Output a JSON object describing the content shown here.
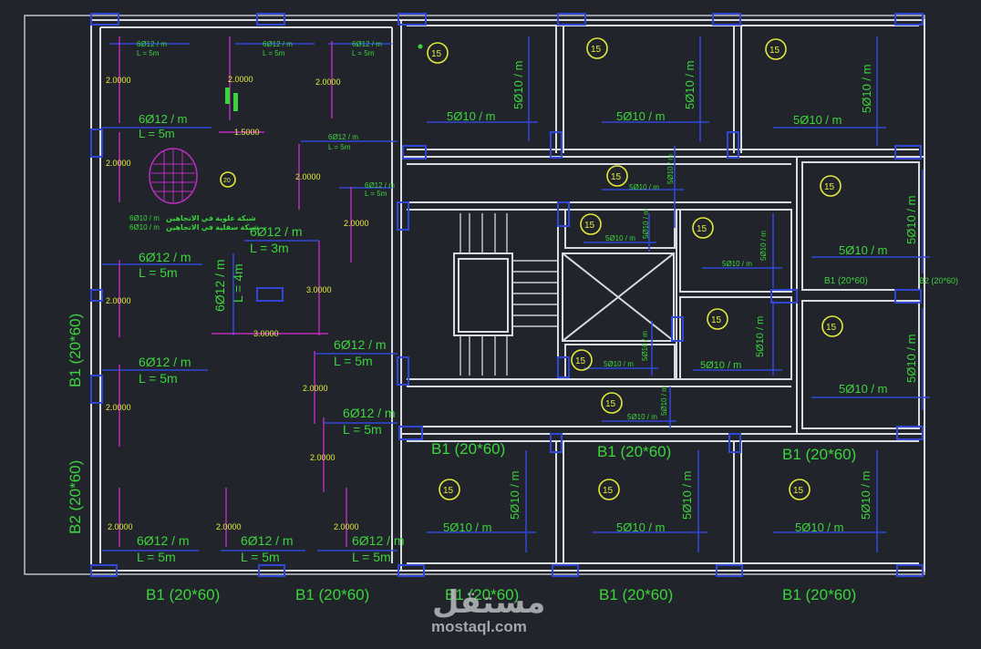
{
  "beams": {
    "bottom": [
      "B1 (20*60)",
      "B1 (20*60)",
      "B1 (20*60)",
      "B1 (20*60)",
      "B1 (20*60)"
    ],
    "middle": [
      "B1 (20*60)",
      "B1 (20*60)",
      "B1 (20*60)"
    ],
    "left": [
      "B1 (20*60)",
      "B2 (20*60)"
    ],
    "small_right": [
      "B1 (20*60)",
      "B2 (20*60)"
    ]
  },
  "slab_thickness": "15",
  "slab_20": "20",
  "rebar": {
    "r6_12": "6Ø12 / m",
    "l5": "L = 5m",
    "l3": "L = 3m",
    "l4": "L = 4m",
    "r5_10": "5Ø10 / m",
    "r6_10": "6Ø10 / m"
  },
  "dims": {
    "d2": "2.0000",
    "d3": "3.0000",
    "d15": "1.5000"
  },
  "notes": {
    "top_mesh": "شبكة علوية في الاتجاهين",
    "bottom_mesh": "شبكة سفلية في الاتجاهين"
  },
  "watermark": {
    "logo": "مستقل",
    "site": "mostaql.com"
  }
}
